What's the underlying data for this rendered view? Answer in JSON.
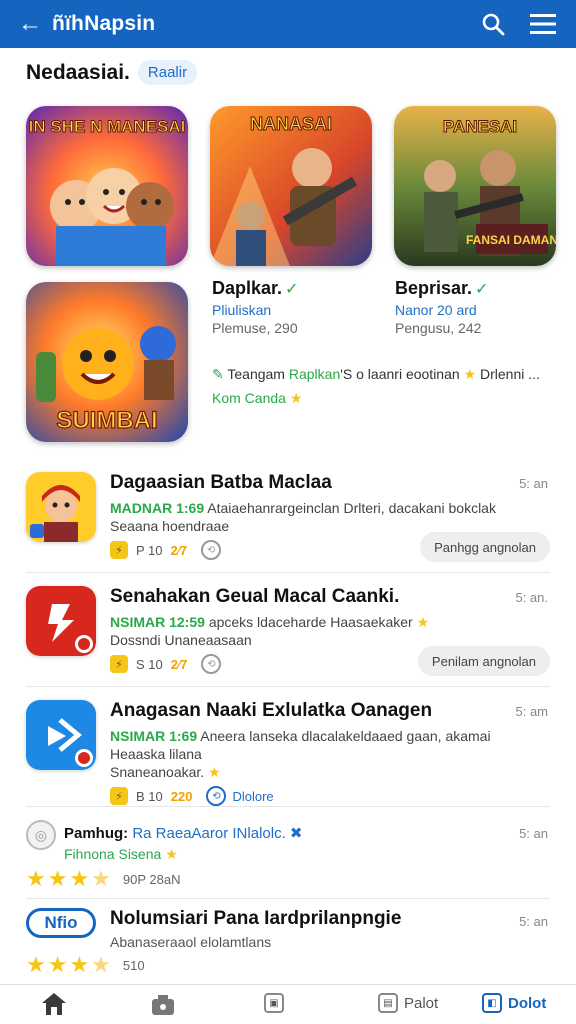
{
  "header": {
    "back_glyph": "←",
    "title": "ñïhNapsin",
    "search_icon": "search-icon",
    "menu_icon": "hamburger-menu-icon"
  },
  "featured": {
    "section_title": "Nedaasiai.",
    "chip": "Raalir",
    "thumb_captions": [
      "IN SHE N MANESAI",
      "NANASAI",
      "PANESAI"
    ],
    "thumb_bottom_caption": "SUIMBAI",
    "thumb_tag_3": "FANSAI DAMAN",
    "cards": [
      {
        "name": "Daplkar.",
        "check": "✓",
        "sub": "Pliuliskan",
        "meta": "Plemuse, 290"
      },
      {
        "name": "Beprisar.",
        "check": "✓",
        "sub": "Nanor 20 ard",
        "meta": "Pengusu, 242"
      }
    ],
    "promo_leaf": "✎",
    "promo_name": "Teangam",
    "promo_hl": "Raplkan",
    "promo_rest": "'S o laanri eootinan",
    "promo_tail": "Drlenni ...",
    "promo_star": "★",
    "promo2": "Kom Canda"
  },
  "apps": [
    {
      "title": "Dagaasian Batba Maclaa",
      "time": "5: an",
      "line1_green": "MADNAR 1:69",
      "line1_rest": "Ataiaehanrargeinclan Drlteri, dacakani bokclak",
      "line2": "Seaana hoendraae",
      "stat_num": "P 10",
      "stat_hot": "2⁄7",
      "button": "Panhgg angnolan"
    },
    {
      "title": "Senahakan Geual Macal Caanki.",
      "time": "5: an.",
      "line1_green": "NSIMAR 12:59",
      "line1_rest": "apceks ldaceharde Haasaekaker",
      "line2": "Dossndi Unaneaasaan",
      "stat_num": "S 10",
      "stat_hot": "2⁄7",
      "button": "Penilam angnolan"
    },
    {
      "title": "Anagasan Naaki Exlulatka Oanagen",
      "time": "5: am",
      "line1_green": "NSIMAR 1:69",
      "line1_rest": "Aneera lanseka dlacalakeldaaed gaan, akamai",
      "line2": "Heaaska lilana",
      "line3": "Snaneanoakar.",
      "stat_num": "B 10",
      "stat_hot": "220",
      "more_label": "Dlolore"
    }
  ],
  "review": {
    "name": "Pamhug:",
    "name_blue": "Ra RaeaAaror INlalolc.",
    "sub": "Fihnona Sisena",
    "time": "5: an",
    "stars": "★★★",
    "stars_dim": "★",
    "count": "90P 28aN"
  },
  "promo_item": {
    "bubble": "Nfio",
    "title": "Nolumsiari Pana Iardprilanpngie",
    "sub": "Abanaseraaol elolamtlans",
    "time": "5: an",
    "stars": "★★★",
    "stars_dim": "★",
    "count": "510"
  },
  "bottom_nav": {
    "item4_label": "Palot",
    "item5_label": "Dolot"
  },
  "colors": {
    "brand": "#1565c0",
    "accent_green": "#2aa84a",
    "star": "#f5c518"
  }
}
